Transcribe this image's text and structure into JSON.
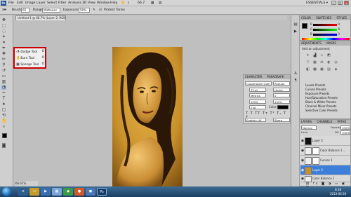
{
  "menubar": {
    "logo": "Ps",
    "items": [
      "File",
      "Edit",
      "Image",
      "Layer",
      "Select",
      "Filter",
      "Analysis",
      "3D",
      "View",
      "Window",
      "Help"
    ],
    "zoom": "66.7",
    "workspace": "ESSENTIALS ▾"
  },
  "options": {
    "brush_label": "Brush:",
    "brush_size": "65",
    "range_label": "Range:",
    "range_value": "Midtones",
    "exposure_label": "Exposure:",
    "exposure_value": "50%",
    "protect_label": "Protect Tones"
  },
  "document": {
    "tab_title": "Untitled-1 @ 66.7% (Layer 2, RGB/8) *",
    "zoom_field": "66.67%"
  },
  "flyout": {
    "items": [
      "Dodge Tool",
      "Burn Tool",
      "Sponge Tool"
    ],
    "shortcut": "O"
  },
  "color_panel": {
    "tabs": [
      "COLOR",
      "SWATCHES",
      "STYLES"
    ],
    "channels": [
      "R",
      "G",
      "B"
    ],
    "values": [
      "0",
      "0",
      "0"
    ]
  },
  "adjustments_panel": {
    "tabs": [
      "ADJUSTMENTS",
      "MASKS"
    ],
    "title": "Add an adjustment",
    "presets": [
      "Levels Presets",
      "Curves Presets",
      "Exposure Presets",
      "Hue/Saturation Presets",
      "Black & White Presets",
      "Channel Mixer Presets",
      "Selective Color Presets"
    ]
  },
  "character_panel": {
    "tabs": [
      "CHARACTER",
      "PARAGRAPH"
    ],
    "font": "Copperplate Goth...",
    "style": "Regular",
    "size": "72 pt",
    "leading": "(Auto)",
    "kerning": "Metrics",
    "tracking": "0",
    "vscale": "100%",
    "hscale": "100%",
    "baseline": "0 pt",
    "color_label": "Color:",
    "language": "English: UK",
    "aa": "Sharp"
  },
  "layers_panel": {
    "tabs": [
      "LAYERS",
      "CHANNELS",
      "PATHS"
    ],
    "blend": "Normal",
    "opacity_label": "Opacity:",
    "opacity": "100%",
    "fill_label": "Fill:",
    "fill": "100%",
    "lock_label": "Lock:",
    "layers": [
      {
        "name": "Layer 2",
        "selected": false
      },
      {
        "name": "Color Balance 1 ...",
        "selected": false
      },
      {
        "name": "Curves 1",
        "selected": false
      },
      {
        "name": "Layer 2",
        "selected": true
      },
      {
        "name": "Color Balance 1",
        "selected": false
      }
    ]
  },
  "taskbar": {
    "time": "8:38",
    "date": "2013-06-26"
  },
  "colors": {
    "accent": "#3d7ed8",
    "photo_tone": "#c8902a",
    "highlight_box": "#cc0000"
  }
}
